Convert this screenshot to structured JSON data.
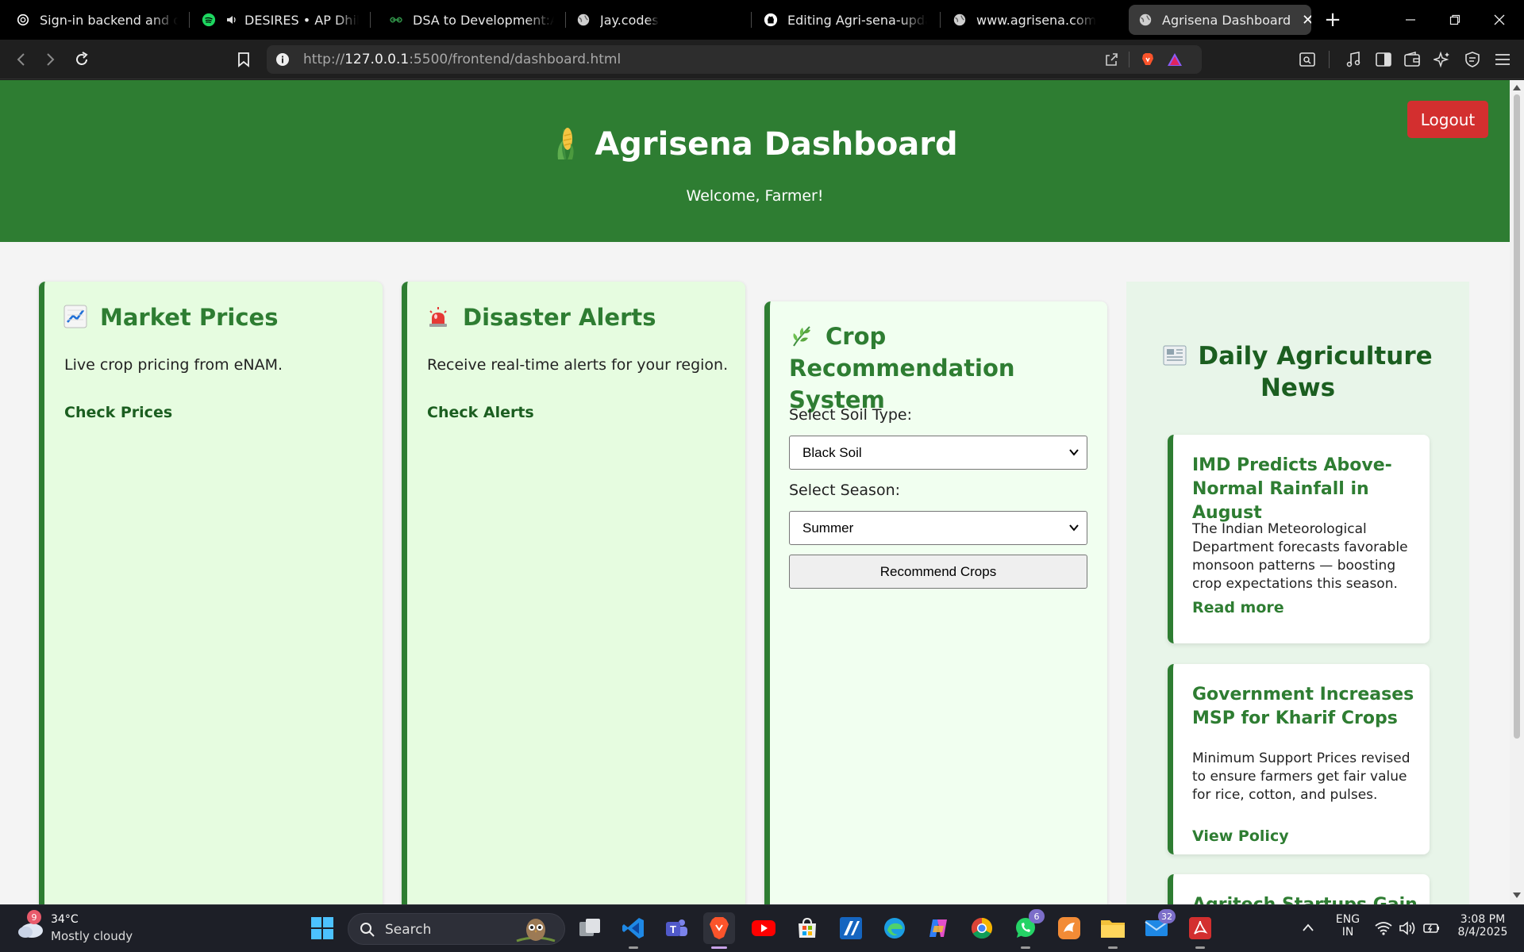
{
  "browser": {
    "tabs": [
      {
        "title": "Sign-in backend and dash",
        "icon": "openai-icon"
      },
      {
        "title": "DESIRES • AP Dhillon, G",
        "icon": "spotify-icon"
      },
      {
        "title": "DSA to Development:A Co",
        "icon": "geeksforgeeks-icon"
      },
      {
        "title": "Jay.codes",
        "icon": "globe-icon"
      },
      {
        "title": "Editing Agri-sena-updates",
        "icon": "github-icon"
      },
      {
        "title": "www.agrisena.com",
        "icon": "globe-icon"
      },
      {
        "title": "Agrisena Dashboard",
        "icon": "globe-icon",
        "active": true
      }
    ],
    "url_prefix": "http://",
    "url_host": "127.0.0.1",
    "url_rest": ":5500/frontend/dashboard.html"
  },
  "page": {
    "title": "Agrisena Dashboard",
    "welcome": "Welcome, Farmer!",
    "logout_label": "Logout",
    "colors": {
      "primary": "#2e7d32",
      "logout": "#d32f2f",
      "card_bg": "#e6fce0",
      "news_bg": "#e8f5e9"
    },
    "cards": {
      "market": {
        "title": "Market Prices",
        "icon": "chart-increasing-icon",
        "desc": "Live crop pricing from eNAM.",
        "link": "Check Prices"
      },
      "disaster": {
        "title": "Disaster Alerts",
        "icon": "police-light-icon",
        "desc": "Receive real-time alerts for your region.",
        "link": "Check Alerts"
      },
      "crop": {
        "title_line1": "Crop Recommendation",
        "title_line2": "System",
        "icon": "herb-icon",
        "soil_label": "Select Soil Type:",
        "soil_value": "Black Soil",
        "season_label": "Select Season:",
        "season_value": "Summer",
        "button": "Recommend Crops"
      }
    },
    "news": {
      "title_line1": "Daily Agriculture",
      "title_line2": "News",
      "icon": "newspaper-icon",
      "items": [
        {
          "title": "IMD Predicts Above-Normal Rainfall in August",
          "body": "The Indian Meteorological Department forecasts favorable monsoon patterns — boosting crop expectations this season.",
          "link": "Read more"
        },
        {
          "title": "Government Increases MSP for Kharif Crops",
          "body": "Minimum Support Prices revised to ensure farmers get fair value for rice, cotton, and pulses.",
          "link": "View Policy"
        },
        {
          "title": "Agritech Startups Gain",
          "body": "",
          "link": ""
        }
      ]
    }
  },
  "taskbar": {
    "weather_temp": "34°C",
    "weather_desc": "Mostly cloudy",
    "weather_badge": "9",
    "search_placeholder": "Search",
    "whatsapp_badge": "6",
    "mail_badge": "32",
    "lang_line1": "ENG",
    "lang_line2": "IN",
    "time": "3:08 PM",
    "date": "8/4/2025"
  }
}
